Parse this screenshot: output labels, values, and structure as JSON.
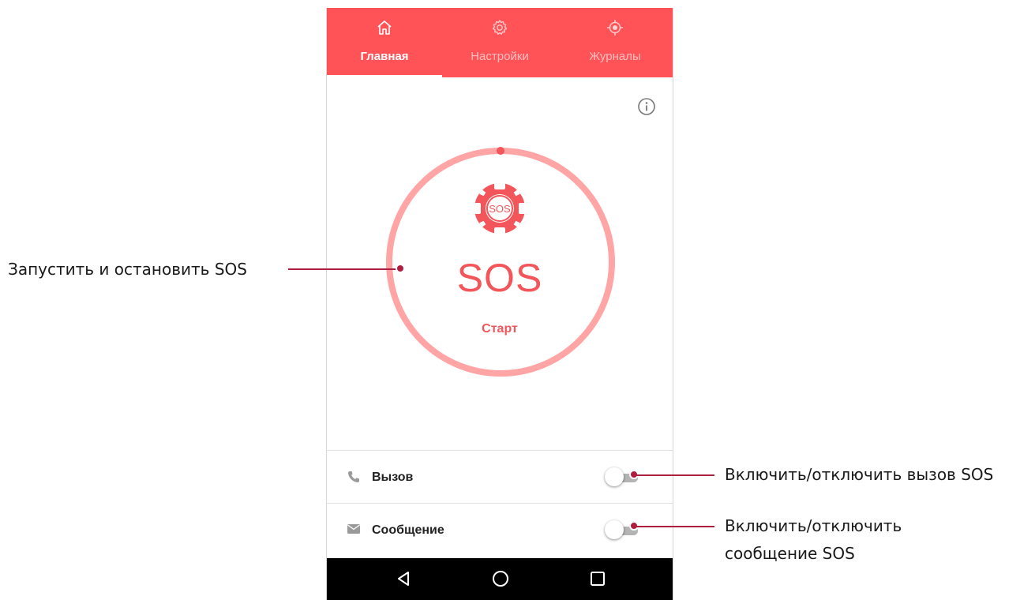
{
  "tabs": [
    {
      "label": "Главная",
      "icon": "home-icon",
      "active": true
    },
    {
      "label": "Настройки",
      "icon": "gear-icon",
      "active": false
    },
    {
      "label": "Журналы",
      "icon": "location-target-icon",
      "active": false
    }
  ],
  "sos": {
    "title": "SOS",
    "badge_text": "SOS",
    "status": "Старт"
  },
  "settings": [
    {
      "label": "Вызов",
      "icon": "phone-icon",
      "enabled": false
    },
    {
      "label": "Сообщение",
      "icon": "envelope-icon",
      "enabled": false
    }
  ],
  "navbar": {
    "buttons": [
      "back-icon",
      "home-circle-icon",
      "recents-square-icon"
    ]
  },
  "callouts": {
    "sos_button": "Запустить и остановить SOS",
    "call_toggle": "Включить/отключить вызов SOS",
    "message_toggle_line1": "Включить/отключить",
    "message_toggle_line2": "сообщение SOS"
  },
  "colors": {
    "accent": "#ff5358",
    "sos_text": "#f2555a",
    "ring": "#ffa5a5",
    "callout": "#b01e3f",
    "toggle_track": "#b4b4b4"
  }
}
